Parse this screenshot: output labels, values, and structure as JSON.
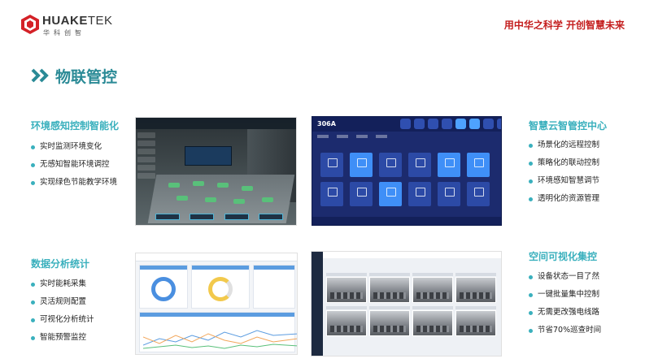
{
  "brand": {
    "name_part1": "HUAKE",
    "name_part2": "TEK",
    "name_cn": "华科创智",
    "logo_color": "#d42127",
    "logo_icon": "hex-cube-logo"
  },
  "slogan": "用中华之科学 开创智慧未来",
  "section": {
    "icon": "double-chevron-icon",
    "title": "物联管控"
  },
  "blocks": [
    {
      "title": "环境感知控制智能化",
      "items": [
        "实时监测环境变化",
        "无感知智能环境调控",
        "实现绿色节能教学环境"
      ]
    },
    {
      "title": "智慧云智管控中心",
      "items": [
        "场景化的远程控制",
        "策略化的联动控制",
        "环境感知智慧调节",
        "透明化的资源管理"
      ]
    },
    {
      "title": "数据分析统计",
      "items": [
        "实时能耗采集",
        "灵活规则配置",
        "可视化分析统计",
        "智能预警监控"
      ]
    },
    {
      "title": "空间可视化集控",
      "items": [
        "设备状态一目了然",
        "一键批量集中控制",
        "无需更改强电线路",
        "节省70%巡查时间"
      ]
    }
  ],
  "screens": {
    "room_3d": "smart-environment-3d-view",
    "control_panel_room": "306A",
    "dashboard": "energy-statistics-dashboard",
    "camera_grid": "classroom-camera-grid"
  },
  "colors": {
    "accent": "#3ab0bd",
    "title": "#2a8a96",
    "slogan": "#c41e1e"
  }
}
